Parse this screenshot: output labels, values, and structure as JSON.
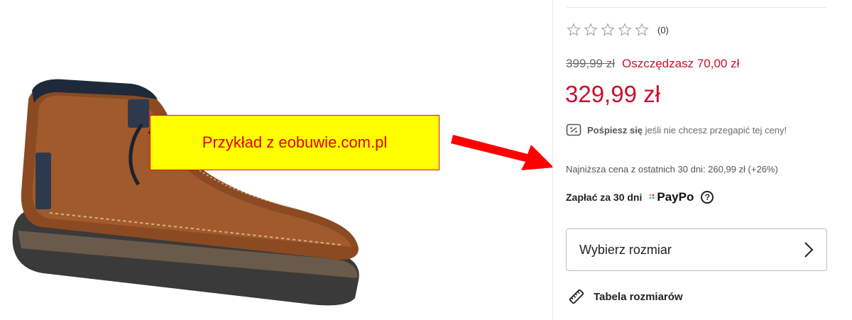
{
  "annotation": {
    "text": "Przykład z eobuwie.com.pl"
  },
  "product": {
    "image_alt": "brown leather chukka boot"
  },
  "rating": {
    "stars_filled": 0,
    "stars_total": 5,
    "count": "(0)"
  },
  "pricing": {
    "old_price": "399,99 zł",
    "savings": "Oszczędzasz 70,00 zł",
    "price": "329,99 zł",
    "hurry_bold": "Pośpiesz się",
    "hurry_rest": "jeśli nie chcesz przegapić tej ceny!",
    "lowest_price": "Najniższa cena z ostatnich 30 dni: 260,99 zł (+26%)"
  },
  "payment": {
    "label": "Zapłać za 30 dni",
    "provider": "PayPo",
    "help_icon": "?"
  },
  "size": {
    "select_label": "Wybierz rozmiar",
    "table_link": "Tabela rozmiarów"
  },
  "colors": {
    "price_red": "#c8102e",
    "annotation_yellow": "#ffff00",
    "annotation_text": "#e00000",
    "arrow_red": "#ff0000"
  }
}
